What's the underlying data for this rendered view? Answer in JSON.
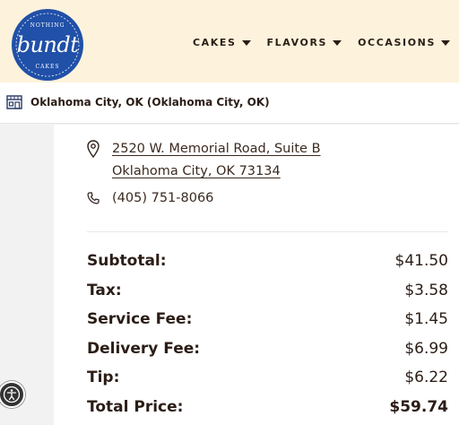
{
  "brand": {
    "logo_word": "bundt",
    "logo_top": "NOTHING",
    "logo_bottom": "CAKES",
    "color": "#2050a8"
  },
  "nav": [
    {
      "label": "CAKES"
    },
    {
      "label": "FLAVORS"
    },
    {
      "label": "OCCASIONS"
    }
  ],
  "location_bar": {
    "icon": "storefront-icon",
    "text": "Oklahoma City, OK (Oklahoma City, OK)"
  },
  "store": {
    "address_line1": "2520 W. Memorial Road, Suite B",
    "address_line2": "Oklahoma City, OK 73134",
    "phone": "(405) 751-8066"
  },
  "totals": [
    {
      "label": "Subtotal:",
      "value": "$41.50"
    },
    {
      "label": "Tax:",
      "value": "$3.58"
    },
    {
      "label": "Service Fee:",
      "value": "$1.45"
    },
    {
      "label": "Delivery Fee:",
      "value": "$6.99"
    },
    {
      "label": "Tip:",
      "value": "$6.22"
    },
    {
      "label": "Total Price:",
      "value": "$59.74"
    }
  ],
  "accessibility": {
    "icon": "accessibility-icon"
  }
}
